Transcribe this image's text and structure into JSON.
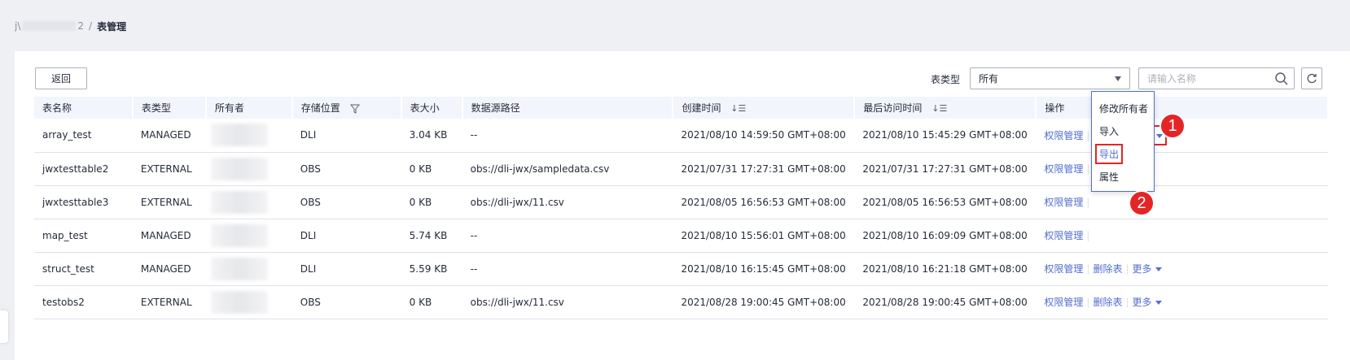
{
  "breadcrumb": {
    "root": "j\\",
    "root_suffix": "2",
    "separator": "/",
    "current": "表管理"
  },
  "toolbar": {
    "back_label": "返回",
    "table_type_label": "表类型",
    "table_type_value": "所有",
    "search_placeholder": "请输入名称"
  },
  "table": {
    "headers": {
      "name": "表名称",
      "type": "表类型",
      "owner": "所有者",
      "location": "存储位置",
      "size": "表大小",
      "data_path": "数据源路径",
      "created": "创建时间",
      "last_access": "最后访问时间",
      "actions": "操作"
    },
    "rows": [
      {
        "name": "array_test",
        "type": "MANAGED",
        "location": "DLI",
        "size": "3.04 KB",
        "data_path": "--",
        "created": "2021/08/10 14:59:50 GMT+08:00",
        "last_access": "2021/08/10 15:45:29 GMT+08:00"
      },
      {
        "name": "jwxtesttable2",
        "type": "EXTERNAL",
        "location": "OBS",
        "size": "0 KB",
        "data_path": "obs://dli-jwx/sampledata.csv",
        "created": "2021/07/31 17:27:31 GMT+08:00",
        "last_access": "2021/07/31 17:27:31 GMT+08:00"
      },
      {
        "name": "jwxtesttable3",
        "type": "EXTERNAL",
        "location": "OBS",
        "size": "0 KB",
        "data_path": "obs://dli-jwx/11.csv",
        "created": "2021/08/05 16:56:53 GMT+08:00",
        "last_access": "2021/08/05 16:56:53 GMT+08:00"
      },
      {
        "name": "map_test",
        "type": "MANAGED",
        "location": "DLI",
        "size": "5.74 KB",
        "data_path": "--",
        "created": "2021/08/10 15:56:01 GMT+08:00",
        "last_access": "2021/08/10 16:09:09 GMT+08:00"
      },
      {
        "name": "struct_test",
        "type": "MANAGED",
        "location": "DLI",
        "size": "5.59 KB",
        "data_path": "--",
        "created": "2021/08/10 16:15:45 GMT+08:00",
        "last_access": "2021/08/10 16:21:18 GMT+08:00"
      },
      {
        "name": "testobs2",
        "type": "EXTERNAL",
        "location": "OBS",
        "size": "0 KB",
        "data_path": "obs://dli-jwx/11.csv",
        "created": "2021/08/28 19:00:45 GMT+08:00",
        "last_access": "2021/08/28 19:00:45 GMT+08:00"
      }
    ],
    "actions": {
      "permissions": "权限管理",
      "delete": "删除表",
      "more": "更多"
    }
  },
  "more_menu": {
    "items": [
      "修改所有者",
      "导入",
      "导出",
      "属性"
    ]
  },
  "annotations": {
    "step1": "1",
    "step2": "2",
    "color": "#e32525"
  },
  "colors": {
    "link": "#526ecc",
    "header_bg": "#f2f5fc",
    "page_bg": "#eff0f4"
  }
}
